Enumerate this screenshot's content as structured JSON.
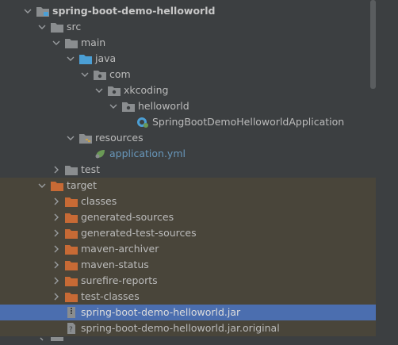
{
  "tree": {
    "project_root": "spring-boot-demo-helloworld",
    "src": "src",
    "main": "main",
    "java": "java",
    "com": "com",
    "xkcoding": "xkcoding",
    "helloworld": "helloworld",
    "app_class": "SpringBootDemoHelloworldApplication",
    "resources": "resources",
    "app_yml": "application.yml",
    "test": "test",
    "target": "target",
    "classes": "classes",
    "generated_sources": "generated-sources",
    "generated_test_sources": "generated-test-sources",
    "maven_archiver": "maven-archiver",
    "maven_status": "maven-status",
    "surefire_reports": "surefire-reports",
    "test_classes": "test-classes",
    "jar": "spring-boot-demo-helloworld.jar",
    "jar_original": "spring-boot-demo-helloworld.jar.original"
  },
  "colors": {
    "panel_bg": "#3c3f41",
    "excluded_bg": "#49453a",
    "selected_bg": "#4b6eaf",
    "folder_gray": "#8a8d8f",
    "folder_blue": "#4b9fd5",
    "folder_orange": "#c76a35",
    "text": "#bbbbbb",
    "link_blue": "#6897bb"
  }
}
